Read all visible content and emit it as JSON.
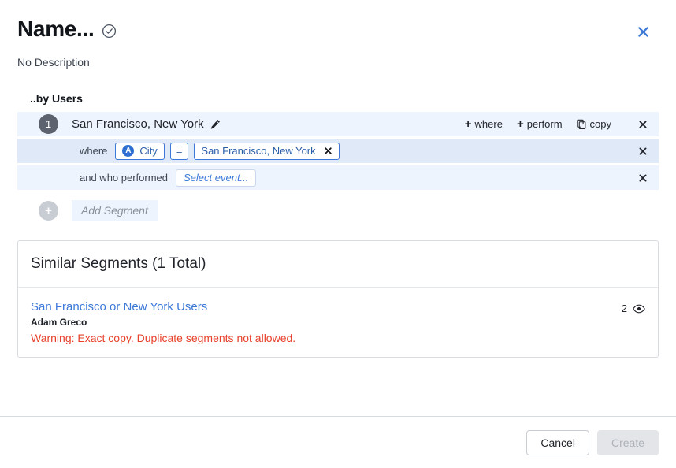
{
  "header": {
    "title": "Name...",
    "verified_icon": "check-circle-icon",
    "description": "No Description",
    "close_icon": "close-icon"
  },
  "builder": {
    "label": "..by Users",
    "segment": {
      "number": "1",
      "name": "San Francisco, New York",
      "edit_icon": "pencil-icon",
      "actions": [
        {
          "id": "add-where",
          "plus": "+",
          "label": "where"
        },
        {
          "id": "add-perform",
          "plus": "+",
          "label": "perform"
        },
        {
          "id": "copy",
          "icon": "copy-icon",
          "label": "copy"
        }
      ],
      "remove_icon": "close-icon"
    },
    "conditions": [
      {
        "id": "where-condition",
        "label": "where",
        "property": {
          "icon_letter": "A",
          "icon_name": "text-property-icon",
          "label": "City"
        },
        "operator": "=",
        "value": "San Francisco, New York",
        "value_clear_icon": "close-icon",
        "remove_icon": "close-icon"
      },
      {
        "id": "performed-condition",
        "label": "and who performed",
        "event_placeholder": "Select event...",
        "remove_icon": "close-icon"
      }
    ],
    "add_segment": {
      "plus": "+",
      "label": "Add Segment"
    }
  },
  "similar_segments": {
    "title": "Similar Segments (1 Total)",
    "rows": [
      {
        "name": "San Francisco or New York Users",
        "author": "Adam Greco",
        "warning": "Warning: Exact copy. Duplicate segments not allowed.",
        "count": "2",
        "visibility_icon": "eye-icon"
      }
    ]
  },
  "footer": {
    "cancel_label": "Cancel",
    "create_label": "Create"
  },
  "colors": {
    "accent_blue": "#3c78d8",
    "row_light": "#eef4fd",
    "row_active": "#dfe9f8",
    "warning_red": "#e8402a",
    "badge_gray": "#5c636e"
  }
}
